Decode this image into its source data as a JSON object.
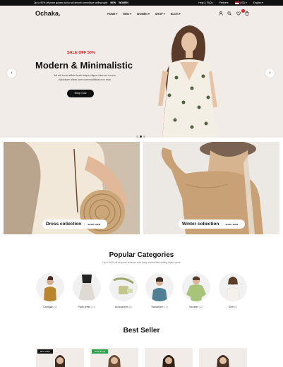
{
  "announcement": {
    "text": "Up to 50% off prom gowns dainur all almost comedisse selling style",
    "links": [
      "MEN",
      "WOMEN"
    ]
  },
  "topbar_right": {
    "help": "Help & FAQs",
    "partners": "Partners",
    "currency": "USD",
    "language": "English"
  },
  "header": {
    "logo": "Ochaka.",
    "nav": [
      "HOME",
      "MEN",
      "WOMEN",
      "SHOP",
      "BLOG"
    ],
    "cart_count": "0"
  },
  "hero": {
    "sale": "SALE OFF 50%",
    "title": "Modern & Minimalistic",
    "subtitle_1": "Ad niti invre afficte trullo sulpa nillpos lolorum Lorem",
    "subtitle_2": "Adidolore olibm ione commoditicial non mon",
    "button": "Shop now",
    "prev": "‹",
    "next": "›"
  },
  "collections": [
    {
      "title": "Dress collection",
      "cta": "SHOP NOW"
    },
    {
      "title": "Winter collection",
      "cta": "SHOP NOW"
    }
  ],
  "categories_section": {
    "title": "Popular Categories",
    "description": "Up to 50% off all prom dresses and hurry comedisse selling styles gonk",
    "items": [
      {
        "name": "Cardigan",
        "count": "(6)"
      },
      {
        "name": "Party dress",
        "count": "(10)"
      },
      {
        "name": "Accessories",
        "count": "(8)"
      },
      {
        "name": "Sweatshirt",
        "count": "(13)"
      },
      {
        "name": "Sweater",
        "count": "(12)"
      },
      {
        "name": "Shirt",
        "count": "(8)"
      }
    ]
  },
  "best_seller": {
    "title": "Best Seller",
    "tags": [
      "Best seller",
      "New arrival"
    ]
  }
}
